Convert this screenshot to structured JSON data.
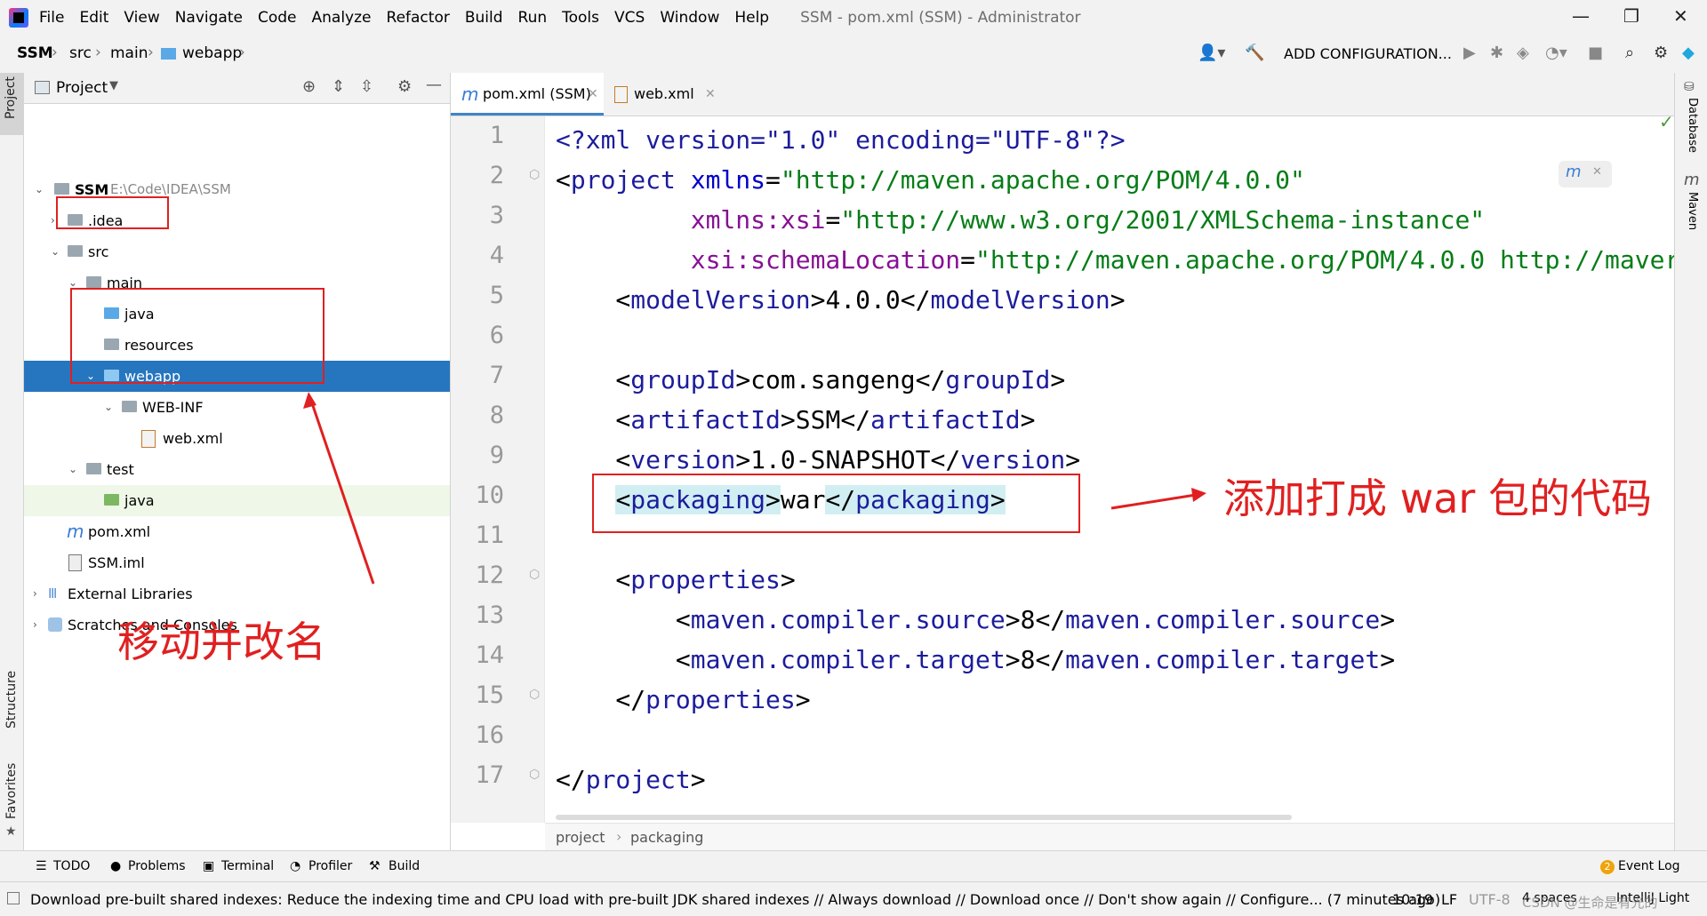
{
  "menu": {
    "items": [
      "File",
      "Edit",
      "View",
      "Navigate",
      "Code",
      "Analyze",
      "Refactor",
      "Build",
      "Run",
      "Tools",
      "VCS",
      "Window",
      "Help"
    ],
    "window_title": "SSM - pom.xml (SSM) - Administrator"
  },
  "breadcrumb": [
    "SSM",
    "src",
    "main",
    "webapp"
  ],
  "toolbar": {
    "add_config": "ADD CONFIGURATION..."
  },
  "project_panel": {
    "title": "Project",
    "stripe_left": [
      "Project",
      "Structure",
      "Favorites"
    ],
    "tree": [
      {
        "label": "SSM",
        "detail": "E:\\Code\\IDEA\\SSM"
      },
      {
        "label": ".idea"
      },
      {
        "label": "src"
      },
      {
        "label": "main"
      },
      {
        "label": "java"
      },
      {
        "label": "resources"
      },
      {
        "label": "webapp"
      },
      {
        "label": "WEB-INF"
      },
      {
        "label": "web.xml"
      },
      {
        "label": "test"
      },
      {
        "label": "java"
      },
      {
        "label": "pom.xml"
      },
      {
        "label": "SSM.iml"
      },
      {
        "label": "External Libraries"
      },
      {
        "label": "Scratches and Consoles"
      }
    ]
  },
  "editor": {
    "tabs": [
      "pom.xml (SSM)",
      "web.xml"
    ],
    "line_numbers": [
      "1",
      "2",
      "3",
      "4",
      "5",
      "6",
      "7",
      "8",
      "9",
      "10",
      "11",
      "12",
      "13",
      "14",
      "15",
      "16",
      "17"
    ],
    "code": {
      "l1": "<?xml version=\"1.0\" encoding=\"UTF-8\"?>",
      "l2_tag": "project",
      "l2_attr": "xmlns",
      "l2_val": "\"http://maven.apache.org/POM/4.0.0\"",
      "l3_attr": "xmlns:xsi",
      "l3_val": "\"http://www.w3.org/2001/XMLSchema-instance\"",
      "l4_attr": "xsi:schemaLocation",
      "l4_val": "\"http://maven.apache.org/POM/4.0.0 http://maver",
      "l5_tag": "modelVersion",
      "l5_val": "4.0.0",
      "l7_tag": "groupId",
      "l7_val": "com.sangeng",
      "l8_tag": "artifactId",
      "l8_val": "SSM",
      "l9_tag": "version",
      "l9_val": "1.0-SNAPSHOT",
      "l10_tag": "packaging",
      "l10_val": "war",
      "l12_tag": "properties",
      "l13_tag": "maven.compiler.source",
      "l13_val": "8",
      "l14_tag": "maven.compiler.target",
      "l14_val": "8",
      "l15_tag": "properties",
      "l17_tag": "project"
    },
    "bottom_breadcrumb": [
      "project",
      "packaging"
    ],
    "right_stripe": [
      "Database",
      "Maven"
    ]
  },
  "tool_stripe": [
    "TODO",
    "Problems",
    "Terminal",
    "Profiler",
    "Build"
  ],
  "event_log": "Event Log",
  "event_count": "2",
  "status": {
    "message": "Download pre-built shared indexes: Reduce the indexing time and CPU load with pre-built JDK shared indexes // Always download // Download once // Don't show again // Configure... (7 minutes ago)",
    "position": "10:19",
    "line_sep": "LF",
    "encoding": "UTF-8",
    "indent": "4 spaces",
    "theme": "IntelliJ Light",
    "watermark": "CSDN @生命是有光的"
  },
  "annotations": {
    "move_rename": "移动并改名",
    "war_code": "添加打成 war 包的代码"
  }
}
